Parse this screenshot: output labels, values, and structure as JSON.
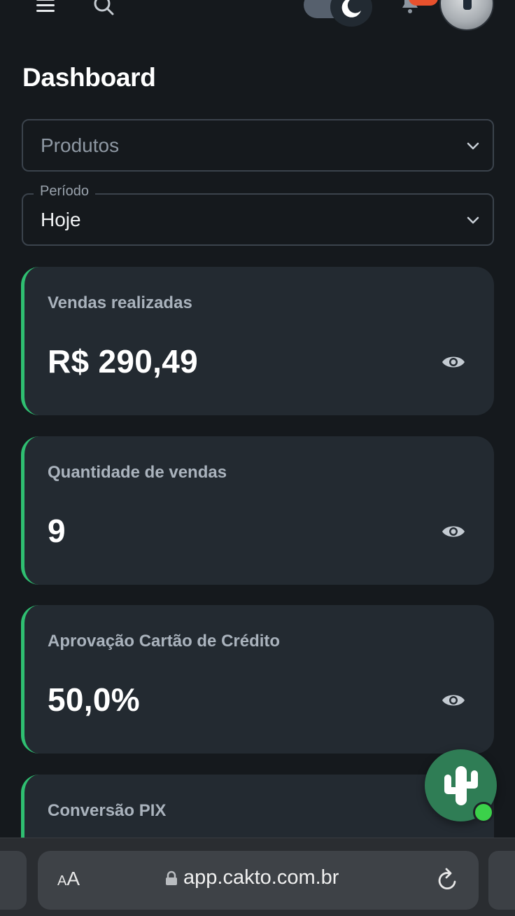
{
  "header": {
    "menu_icon": "hamburger-menu-icon",
    "search_icon": "search-icon",
    "theme_toggle": "dark-mode-toggle",
    "notification_icon": "bell-icon",
    "avatar": "user-avatar"
  },
  "page": {
    "title": "Dashboard"
  },
  "filters": {
    "products_placeholder": "Produtos",
    "period_label": "Período",
    "period_value": "Hoje"
  },
  "cards": [
    {
      "label": "Vendas realizadas",
      "value": "R$ 290,49"
    },
    {
      "label": "Quantidade de vendas",
      "value": "9"
    },
    {
      "label": "Aprovação Cartão de Crédito",
      "value": "50,0%"
    },
    {
      "label": "Conversão PIX",
      "value": ""
    }
  ],
  "colors": {
    "accent": "#2fbf71",
    "background": "#15191d",
    "card": "#232a31",
    "badge": "#e8512d",
    "online": "#3bd14a"
  },
  "browser": {
    "text_size_small": "A",
    "text_size_large": "A",
    "url": "app.cakto.com.br"
  }
}
